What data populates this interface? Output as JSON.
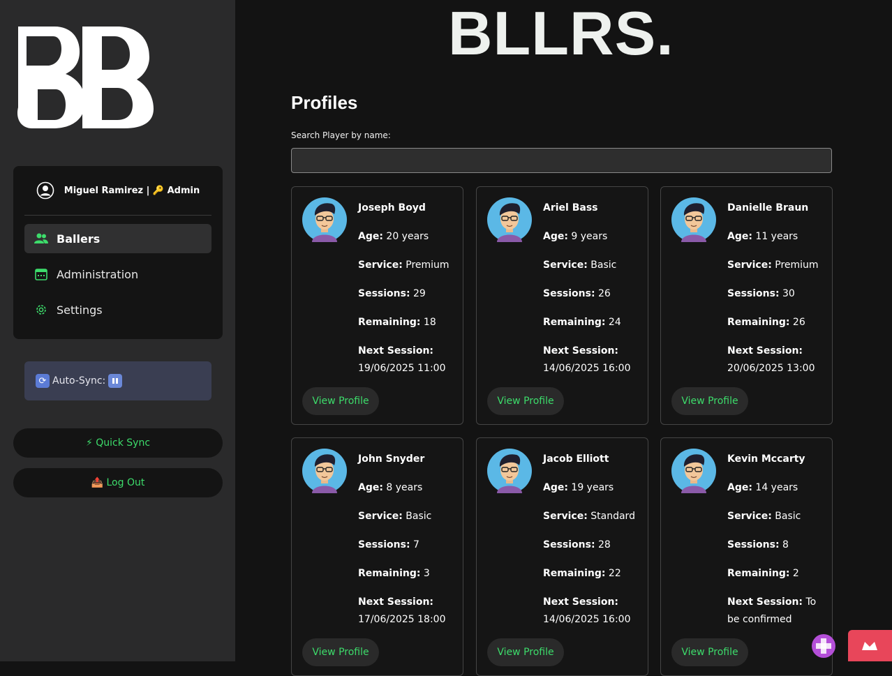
{
  "brand": {
    "sidebar_logo": "BB",
    "main_logo": "BLLRS."
  },
  "user": {
    "label": "Miguel Ramirez | 🔑 Admin"
  },
  "nav": [
    {
      "label": "Ballers",
      "icon": "users-icon",
      "active": true
    },
    {
      "label": "Administration",
      "icon": "calendar-icon",
      "active": false
    },
    {
      "label": "Settings",
      "icon": "gear-icon",
      "active": false
    }
  ],
  "autosync": {
    "label": "Auto-Sync:"
  },
  "quick_sync": {
    "label": "⚡ Quick Sync"
  },
  "logout": {
    "label": "📤 Log Out"
  },
  "page": {
    "title": "Profiles"
  },
  "search": {
    "label": "Search Player by name:",
    "value": "",
    "placeholder": ""
  },
  "labels": {
    "age": "Age:",
    "service": "Service:",
    "sessions": "Sessions:",
    "remaining": "Remaining:",
    "next_session": "Next Session:",
    "view_profile": "View Profile"
  },
  "profiles": [
    {
      "name": "Joseph Boyd",
      "age": "20 years",
      "service": "Premium",
      "sessions": "29",
      "remaining": "18",
      "next": "19/06/2025 11:00"
    },
    {
      "name": "Ariel Bass",
      "age": "9 years",
      "service": "Basic",
      "sessions": "26",
      "remaining": "24",
      "next": "14/06/2025 16:00"
    },
    {
      "name": "Danielle Braun",
      "age": "11 years",
      "service": "Premium",
      "sessions": "30",
      "remaining": "26",
      "next": "20/06/2025 13:00"
    },
    {
      "name": "John Snyder",
      "age": "8 years",
      "service": "Basic",
      "sessions": "7",
      "remaining": "3",
      "next": "17/06/2025 18:00"
    },
    {
      "name": "Jacob Elliott",
      "age": "19 years",
      "service": "Standard",
      "sessions": "28",
      "remaining": "22",
      "next": "14/06/2025 16:00"
    },
    {
      "name": "Kevin Mccarty",
      "age": "14 years",
      "service": "Basic",
      "sessions": "8",
      "remaining": "2",
      "next": "To be confirmed"
    }
  ],
  "colors": {
    "accent": "#3ddc6b",
    "sidebar": "#2a2a2b",
    "background": "#131313"
  }
}
